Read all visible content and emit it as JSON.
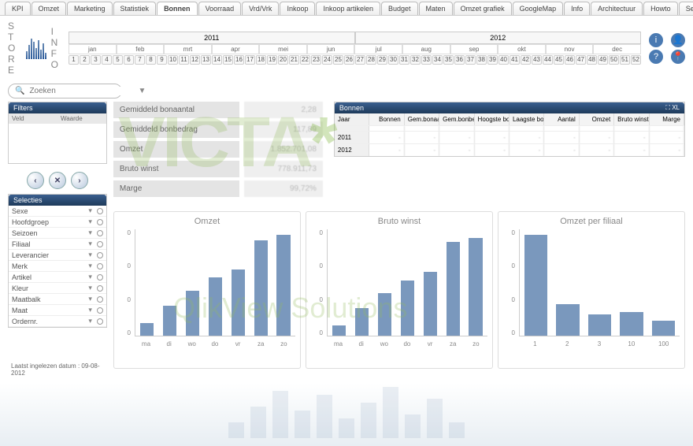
{
  "tabs": [
    "KPI",
    "Omzet",
    "Marketing",
    "Statistiek",
    "Bonnen",
    "Voorraad",
    "Vrd/Vrk",
    "Inkoop",
    "Inkoop artikelen",
    "Budget",
    "Maten",
    "Omzet grafiek",
    "GoogleMap",
    "Info",
    "Architectuur",
    "Howto",
    "Settings"
  ],
  "active_tab": "Bonnen",
  "logo": {
    "left": "S T O R E",
    "right": "I N F O"
  },
  "years": [
    "2011",
    "2012"
  ],
  "months": [
    "jan",
    "feb",
    "mrt",
    "apr",
    "mei",
    "jun",
    "jul",
    "aug",
    "sep",
    "okt",
    "nov",
    "dec"
  ],
  "search": {
    "placeholder": "Zoeken"
  },
  "filters_panel": {
    "title": "Filters",
    "col1": "Veld",
    "col2": "Waarde"
  },
  "selecties_panel": {
    "title": "Selecties",
    "items": [
      "Sexe",
      "Hoofdgroep",
      "Seizoen",
      "Filiaal",
      "Leverancier",
      "Merk",
      "Artikel",
      "Kleur",
      "Maatbalk",
      "Maat",
      "Ordernr."
    ]
  },
  "kpi": [
    {
      "label": "Gemiddeld bonaantal",
      "value": "2,28"
    },
    {
      "label": "Gemiddeld bonbedrag",
      "value": "117,89"
    },
    {
      "label": "Omzet",
      "value": "1.852.701,08"
    },
    {
      "label": "Bruto winst",
      "value": "778.911,73"
    },
    {
      "label": "Marge",
      "value": "99,72%"
    }
  ],
  "bonnen_panel": {
    "title": "Bonnen",
    "columns": [
      "Jaar",
      "Bonnen",
      "Gem.bonaant...",
      "Gem.bonbedrag",
      "Hoogste bon",
      "Laagste bon",
      "Aantal",
      "Omzet",
      "Bruto winst",
      "Marge"
    ],
    "rows": [
      {
        "year": "",
        "cells": [
          "",
          "",
          "",
          "",
          "",
          "",
          "",
          "",
          ""
        ]
      },
      {
        "year": "2011",
        "cells": [
          "-",
          "-",
          "-",
          "-",
          "-",
          "-",
          "-",
          "-",
          "-"
        ]
      },
      {
        "year": "2012",
        "cells": [
          "-",
          "-",
          "-",
          "-",
          "-",
          "-",
          "-",
          "-",
          "-"
        ]
      }
    ]
  },
  "footer": "Laatst ingelezen datum : 09-08-2012",
  "chart_data": [
    {
      "type": "bar",
      "title": "Omzet",
      "categories": [
        "ma",
        "di",
        "wo",
        "do",
        "vr",
        "za",
        "zo"
      ],
      "values": [
        12,
        28,
        42,
        55,
        62,
        90,
        95
      ],
      "ylim": [
        0,
        100
      ]
    },
    {
      "type": "bar",
      "title": "Bruto winst",
      "categories": [
        "ma",
        "di",
        "wo",
        "do",
        "vr",
        "za",
        "zo"
      ],
      "values": [
        10,
        26,
        40,
        52,
        60,
        88,
        92
      ],
      "ylim": [
        0,
        100
      ]
    },
    {
      "type": "bar",
      "title": "Omzet per filiaal",
      "categories": [
        "1",
        "2",
        "3",
        "10",
        "100"
      ],
      "values": [
        95,
        30,
        20,
        22,
        14
      ],
      "ylim": [
        0,
        100
      ]
    }
  ],
  "watermark": {
    "main": "VICTA",
    "sub": "QlikView Solutions"
  }
}
